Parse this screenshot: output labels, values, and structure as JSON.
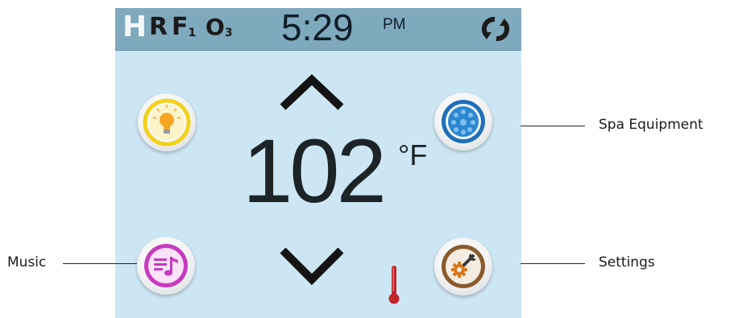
{
  "status_bar": {
    "indicators": {
      "h": "H",
      "r": "R",
      "f1_main": "F",
      "f1_sub": "1",
      "o3_main": "O",
      "o3_sub": "3"
    },
    "time": "5:29",
    "ampm": "PM",
    "sync_icon": "sync-icon"
  },
  "main": {
    "temperature": "102",
    "unit": "°F",
    "up_icon": "chevron-up-icon",
    "down_icon": "chevron-down-icon",
    "thermometer_icon": "thermometer-icon"
  },
  "buttons": {
    "light": {
      "icon": "light-bulb-icon"
    },
    "spa_equipment": {
      "icon": "jets-icon"
    },
    "music": {
      "icon": "music-icon"
    },
    "settings": {
      "icon": "settings-icon"
    }
  },
  "callouts": {
    "spa_equipment": "Spa Equipment",
    "music": "Music",
    "settings": "Settings"
  },
  "colors": {
    "screen_bg": "#cde6f4",
    "status_bar_bg": "#7fa9bd",
    "light_ring": "#f2d21a",
    "equip_ring": "#1e6fb8",
    "music_ring": "#c63bbf",
    "settings_ring": "#8a5a2b",
    "thermometer": "#c0262b"
  }
}
